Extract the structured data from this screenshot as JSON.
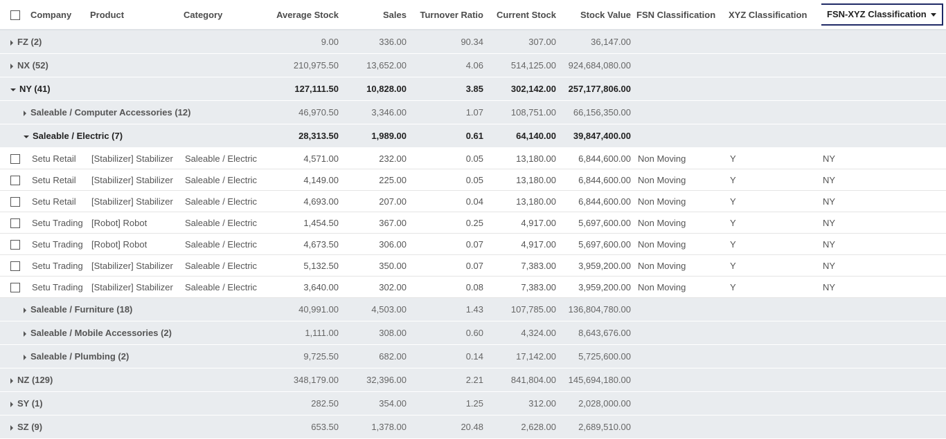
{
  "headers": {
    "company": "Company",
    "product": "Product",
    "category": "Category",
    "avg_stock": "Average Stock",
    "sales": "Sales",
    "turnover": "Turnover Ratio",
    "current_stock": "Current Stock",
    "stock_value": "Stock Value",
    "fsn": "FSN Classification",
    "xyz": "XYZ Classification",
    "fsn_xyz": "FSN-XYZ Classification"
  },
  "groups": {
    "fz": {
      "label": "FZ (2)",
      "avg": "9.00",
      "sales": "336.00",
      "turnover": "90.34",
      "current": "307.00",
      "value": "36,147.00"
    },
    "nx": {
      "label": "NX (52)",
      "avg": "210,975.50",
      "sales": "13,652.00",
      "turnover": "4.06",
      "current": "514,125.00",
      "value": "924,684,080.00"
    },
    "ny": {
      "label": "NY (41)",
      "avg": "127,111.50",
      "sales": "10,828.00",
      "turnover": "3.85",
      "current": "302,142.00",
      "value": "257,177,806.00"
    },
    "nz": {
      "label": "NZ (129)",
      "avg": "348,179.00",
      "sales": "32,396.00",
      "turnover": "2.21",
      "current": "841,804.00",
      "value": "145,694,180.00"
    },
    "sy": {
      "label": "SY (1)",
      "avg": "282.50",
      "sales": "354.00",
      "turnover": "1.25",
      "current": "312.00",
      "value": "2,028,000.00"
    },
    "sz": {
      "label": "SZ (9)",
      "avg": "653.50",
      "sales": "1,378.00",
      "turnover": "20.48",
      "current": "2,628.00",
      "value": "2,689,510.00"
    }
  },
  "subgroups": {
    "computer": {
      "label": "Saleable / Computer Accessories (12)",
      "avg": "46,970.50",
      "sales": "3,346.00",
      "turnover": "1.07",
      "current": "108,751.00",
      "value": "66,156,350.00"
    },
    "electric": {
      "label": "Saleable / Electric (7)",
      "avg": "28,313.50",
      "sales": "1,989.00",
      "turnover": "0.61",
      "current": "64,140.00",
      "value": "39,847,400.00"
    },
    "furniture": {
      "label": "Saleable / Furniture (18)",
      "avg": "40,991.00",
      "sales": "4,503.00",
      "turnover": "1.43",
      "current": "107,785.00",
      "value": "136,804,780.00"
    },
    "mobile": {
      "label": "Saleable / Mobile Accessories (2)",
      "avg": "1,111.00",
      "sales": "308.00",
      "turnover": "0.60",
      "current": "4,324.00",
      "value": "8,643,676.00"
    },
    "plumbing": {
      "label": "Saleable / Plumbing (2)",
      "avg": "9,725.50",
      "sales": "682.00",
      "turnover": "0.14",
      "current": "17,142.00",
      "value": "5,725,600.00"
    }
  },
  "records": [
    {
      "company": "Setu Retail",
      "product": "[Stabilizer] Stabilizer",
      "category": "Saleable / Electric",
      "avg": "4,571.00",
      "sales": "232.00",
      "turnover": "0.05",
      "current": "13,180.00",
      "value": "6,844,600.00",
      "fsn": "Non Moving",
      "xyz": "Y",
      "fsn_xyz": "NY"
    },
    {
      "company": "Setu Retail",
      "product": "[Stabilizer] Stabilizer",
      "category": "Saleable / Electric",
      "avg": "4,149.00",
      "sales": "225.00",
      "turnover": "0.05",
      "current": "13,180.00",
      "value": "6,844,600.00",
      "fsn": "Non Moving",
      "xyz": "Y",
      "fsn_xyz": "NY"
    },
    {
      "company": "Setu Retail",
      "product": "[Stabilizer] Stabilizer",
      "category": "Saleable / Electric",
      "avg": "4,693.00",
      "sales": "207.00",
      "turnover": "0.04",
      "current": "13,180.00",
      "value": "6,844,600.00",
      "fsn": "Non Moving",
      "xyz": "Y",
      "fsn_xyz": "NY"
    },
    {
      "company": "Setu Trading",
      "product": "[Robot] Robot",
      "category": "Saleable / Electric",
      "avg": "1,454.50",
      "sales": "367.00",
      "turnover": "0.25",
      "current": "4,917.00",
      "value": "5,697,600.00",
      "fsn": "Non Moving",
      "xyz": "Y",
      "fsn_xyz": "NY"
    },
    {
      "company": "Setu Trading",
      "product": "[Robot] Robot",
      "category": "Saleable / Electric",
      "avg": "4,673.50",
      "sales": "306.00",
      "turnover": "0.07",
      "current": "4,917.00",
      "value": "5,697,600.00",
      "fsn": "Non Moving",
      "xyz": "Y",
      "fsn_xyz": "NY"
    },
    {
      "company": "Setu Trading",
      "product": "[Stabilizer] Stabilizer",
      "category": "Saleable / Electric",
      "avg": "5,132.50",
      "sales": "350.00",
      "turnover": "0.07",
      "current": "7,383.00",
      "value": "3,959,200.00",
      "fsn": "Non Moving",
      "xyz": "Y",
      "fsn_xyz": "NY"
    },
    {
      "company": "Setu Trading",
      "product": "[Stabilizer] Stabilizer",
      "category": "Saleable / Electric",
      "avg": "3,640.00",
      "sales": "302.00",
      "turnover": "0.08",
      "current": "7,383.00",
      "value": "3,959,200.00",
      "fsn": "Non Moving",
      "xyz": "Y",
      "fsn_xyz": "NY"
    }
  ]
}
